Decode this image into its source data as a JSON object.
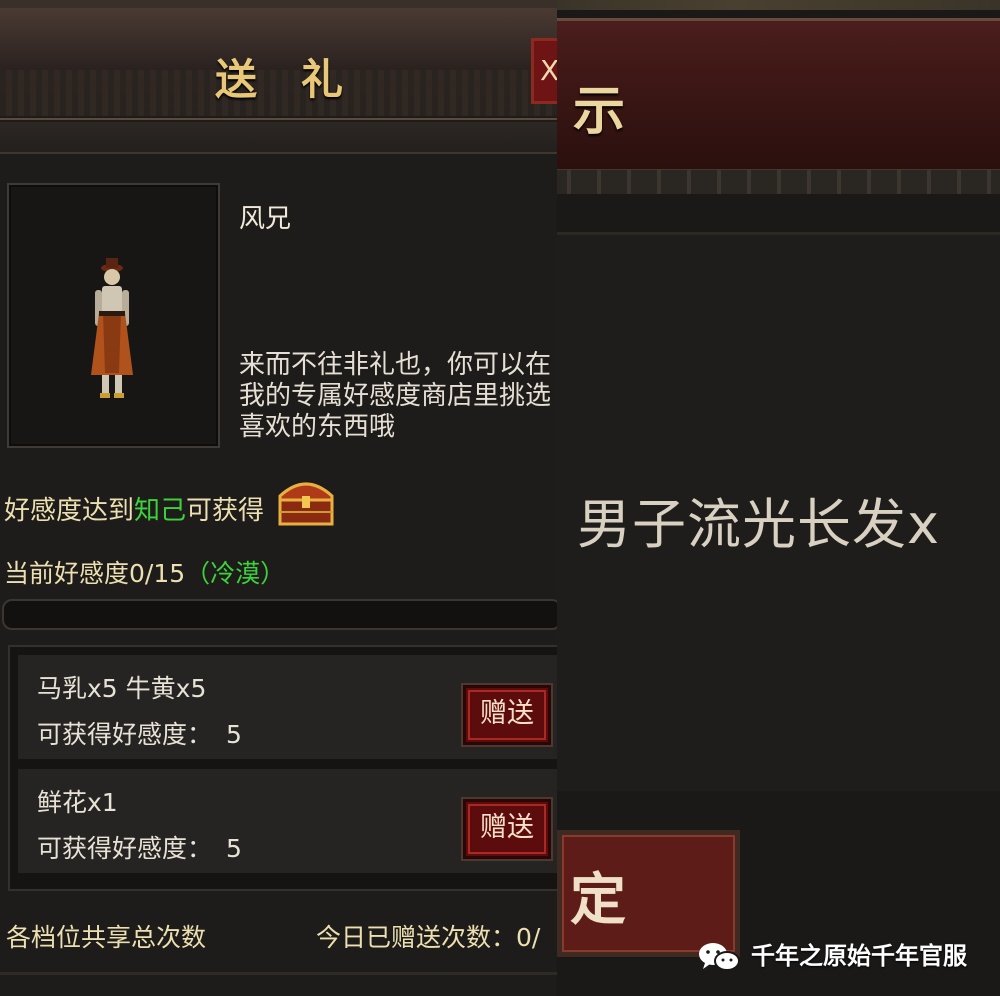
{
  "gift_panel": {
    "title": "送礼",
    "close_label": "X",
    "npc_name": "风兄",
    "npc_dialog": "来而不往非礼也，你可以在我的专属好感度商店里挑选喜欢的东西哦",
    "reward_hint": {
      "prefix": "好感度达到",
      "level": "知己",
      "suffix": "可获得",
      "reward_icon": "treasure-chest-icon"
    },
    "current_favor": {
      "prefix": "当前好感度",
      "value": "0/15",
      "status": "（冷漠）"
    },
    "favor_progress": 0,
    "gifts": [
      {
        "items": "马乳x5 牛黄x5",
        "gain_label": "可获得好感度：",
        "gain_value": "5",
        "button": "赠送"
      },
      {
        "items": "鲜花x1",
        "gain_label": "可获得好感度：",
        "gain_value": "5",
        "button": "赠送"
      }
    ],
    "footer_left": "各档位共享总次数",
    "footer_right": "今日已赠送次数：0/"
  },
  "notice_panel": {
    "title": "示",
    "item_text": "男子流光长发x",
    "confirm_label": "定"
  },
  "watermark": "千年之原始千年官服",
  "colors": {
    "gold": "#e8c878",
    "green": "#3cd23c",
    "button_red": "#5c0c0c"
  }
}
